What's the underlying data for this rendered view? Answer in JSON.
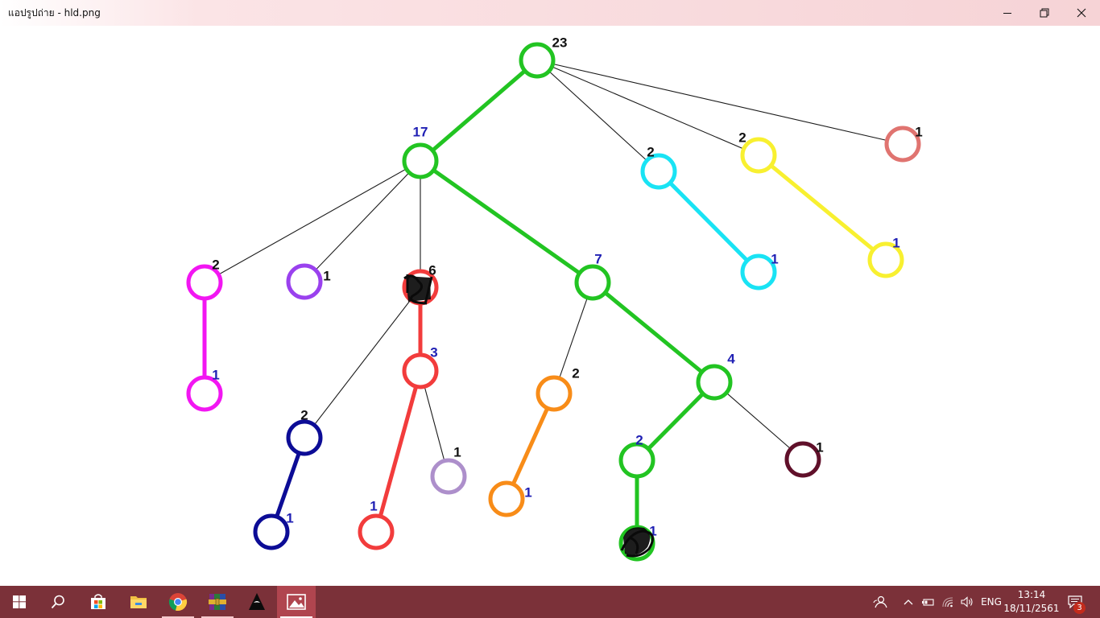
{
  "window": {
    "title": "แอปรูปถ่าย - hld.png",
    "controls": [
      "minimize-icon",
      "restore-icon",
      "close-icon"
    ]
  },
  "image": {
    "colors": {
      "green": "#22c422",
      "cyan": "#19e3f4",
      "yellow": "#f8f030",
      "salmon": "#e07470",
      "magenta": "#f216f2",
      "purple": "#9a41ee",
      "red": "#f23c3c",
      "navy": "#0c0c96",
      "orange": "#f88c18",
      "lavender": "#ad8fcb",
      "maroon": "#60102a",
      "black_label": "#111111",
      "blue_label": "#2020b4"
    },
    "nodes": [
      {
        "id": "root",
        "label": "23",
        "color": "green",
        "label_color": "black"
      },
      {
        "id": "n17",
        "label": "17",
        "color": "green",
        "label_color": "blue"
      },
      {
        "id": "cyan2",
        "label": "2",
        "color": "cyan",
        "label_color": "black"
      },
      {
        "id": "yel2",
        "label": "2",
        "color": "yellow",
        "label_color": "black"
      },
      {
        "id": "sal1",
        "label": "1",
        "color": "salmon",
        "label_color": "black"
      },
      {
        "id": "cyan1",
        "label": "1",
        "color": "cyan",
        "label_color": "blue"
      },
      {
        "id": "yel1",
        "label": "1",
        "color": "yellow",
        "label_color": "blue"
      },
      {
        "id": "mag2",
        "label": "2",
        "color": "magenta",
        "label_color": "black"
      },
      {
        "id": "pur1",
        "label": "1",
        "color": "purple",
        "label_color": "black"
      },
      {
        "id": "red6",
        "label": "6",
        "color": "red",
        "label_color": "black"
      },
      {
        "id": "g7",
        "label": "7",
        "color": "green",
        "label_color": "blue"
      },
      {
        "id": "mag1",
        "label": "1",
        "color": "magenta",
        "label_color": "blue"
      },
      {
        "id": "red3",
        "label": "3",
        "color": "red",
        "label_color": "blue"
      },
      {
        "id": "or2",
        "label": "2",
        "color": "orange",
        "label_color": "black"
      },
      {
        "id": "g4",
        "label": "4",
        "color": "green",
        "label_color": "blue"
      },
      {
        "id": "nav2",
        "label": "2",
        "color": "navy",
        "label_color": "black"
      },
      {
        "id": "lav1",
        "label": "1",
        "color": "lavender",
        "label_color": "black"
      },
      {
        "id": "g2",
        "label": "2",
        "color": "green",
        "label_color": "blue"
      },
      {
        "id": "mar1",
        "label": "1",
        "color": "maroon",
        "label_color": "black"
      },
      {
        "id": "nav1",
        "label": "1",
        "color": "navy",
        "label_color": "blue"
      },
      {
        "id": "red1",
        "label": "1",
        "color": "red",
        "label_color": "blue"
      },
      {
        "id": "or1",
        "label": "1",
        "color": "orange",
        "label_color": "blue"
      },
      {
        "id": "g1",
        "label": "1",
        "color": "green",
        "label_color": "blue"
      }
    ],
    "edges": [
      {
        "from": "root",
        "to": "n17",
        "type": "heavy",
        "color": "green"
      },
      {
        "from": "root",
        "to": "cyan2",
        "type": "light"
      },
      {
        "from": "root",
        "to": "yel2",
        "type": "light"
      },
      {
        "from": "root",
        "to": "sal1",
        "type": "light"
      },
      {
        "from": "cyan2",
        "to": "cyan1",
        "type": "heavy",
        "color": "cyan"
      },
      {
        "from": "yel2",
        "to": "yel1",
        "type": "heavy",
        "color": "yellow"
      },
      {
        "from": "n17",
        "to": "mag2",
        "type": "light"
      },
      {
        "from": "n17",
        "to": "pur1",
        "type": "light"
      },
      {
        "from": "n17",
        "to": "red6",
        "type": "light"
      },
      {
        "from": "n17",
        "to": "g7",
        "type": "heavy",
        "color": "green"
      },
      {
        "from": "mag2",
        "to": "mag1",
        "type": "heavy",
        "color": "magenta"
      },
      {
        "from": "red6",
        "to": "red3",
        "type": "heavy",
        "color": "red"
      },
      {
        "from": "red6",
        "to": "nav2",
        "type": "light"
      },
      {
        "from": "red3",
        "to": "red1",
        "type": "heavy",
        "color": "red"
      },
      {
        "from": "red3",
        "to": "lav1",
        "type": "light"
      },
      {
        "from": "nav2",
        "to": "nav1",
        "type": "heavy",
        "color": "navy"
      },
      {
        "from": "g7",
        "to": "or2",
        "type": "light"
      },
      {
        "from": "g7",
        "to": "g4",
        "type": "heavy",
        "color": "green"
      },
      {
        "from": "or2",
        "to": "or1",
        "type": "heavy",
        "color": "orange"
      },
      {
        "from": "g4",
        "to": "g2",
        "type": "heavy",
        "color": "green"
      },
      {
        "from": "g4",
        "to": "mar1",
        "type": "light"
      },
      {
        "from": "g2",
        "to": "g1",
        "type": "heavy",
        "color": "green"
      }
    ],
    "scribbled_nodes": [
      "red6",
      "g1"
    ]
  },
  "taskbar": {
    "apps": [
      {
        "name": "start-button",
        "icon": "windows-logo-icon"
      },
      {
        "name": "search-button",
        "icon": "search-icon"
      },
      {
        "name": "store-app",
        "icon": "store-icon"
      },
      {
        "name": "file-explorer-app",
        "icon": "folder-icon"
      },
      {
        "name": "chrome-app",
        "icon": "chrome-icon"
      },
      {
        "name": "winrar-app",
        "icon": "winrar-icon"
      },
      {
        "name": "vpn-app",
        "icon": "hooded-figure-icon"
      },
      {
        "name": "photos-app",
        "icon": "photos-icon"
      }
    ],
    "tray": {
      "language": "ENG",
      "time": "13:14",
      "date": "18/11/2561",
      "notification_count": "3"
    }
  }
}
